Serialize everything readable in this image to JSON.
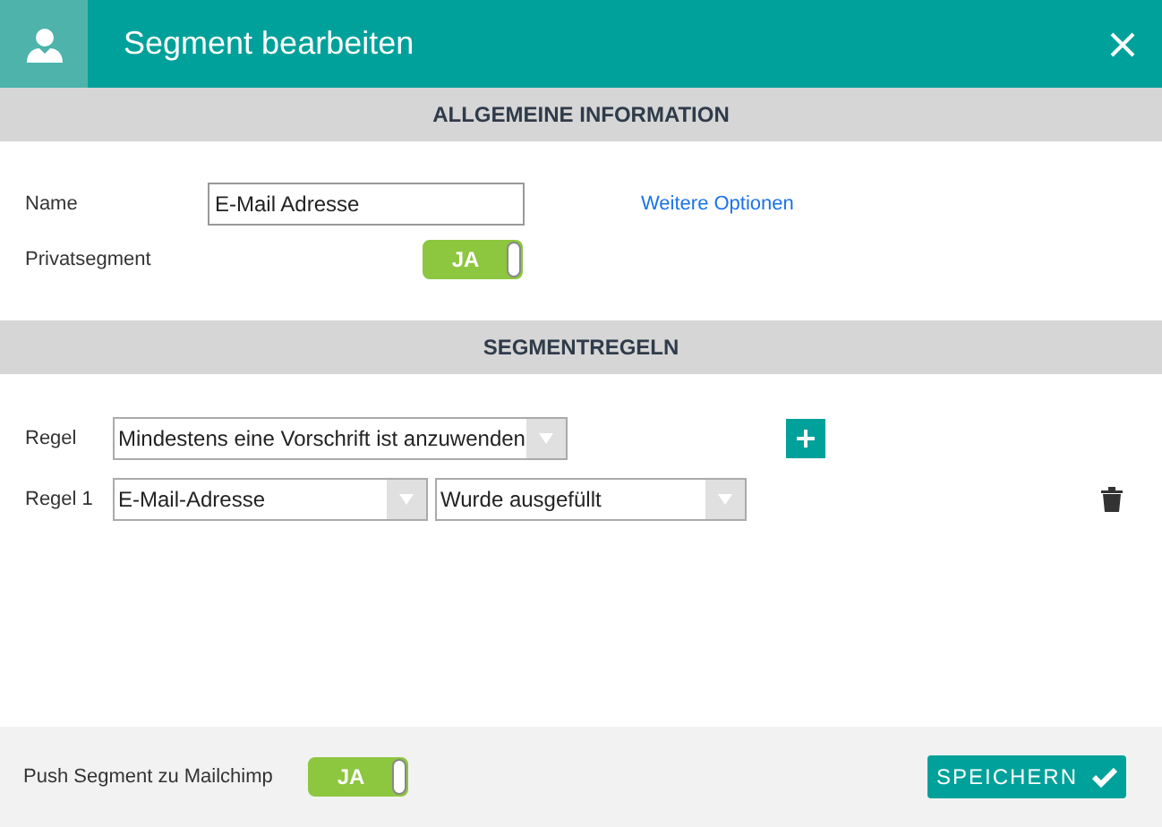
{
  "header": {
    "title": "Segment bearbeiten"
  },
  "general": {
    "heading": "ALLGEMEINE INFORMATION",
    "name": {
      "label": "Name",
      "value": "E-Mail Adresse"
    },
    "link": "Weitere Optionen",
    "private": {
      "label": "Privatsegment",
      "on": true,
      "text": "JA"
    }
  },
  "rules": {
    "heading": "SEGMENTREGELN",
    "mode": {
      "label": "Regel",
      "value": "Mindestens eine Vorschrift ist anzuwenden"
    },
    "items": [
      {
        "label": "Regel 1",
        "field": "E-Mail-Adresse",
        "condition": "Wurde ausgefüllt"
      }
    ]
  },
  "footer": {
    "push": {
      "label": "Push Segment zu Mailchimp",
      "on": true,
      "text": "JA"
    },
    "save": "SPEICHERN"
  }
}
